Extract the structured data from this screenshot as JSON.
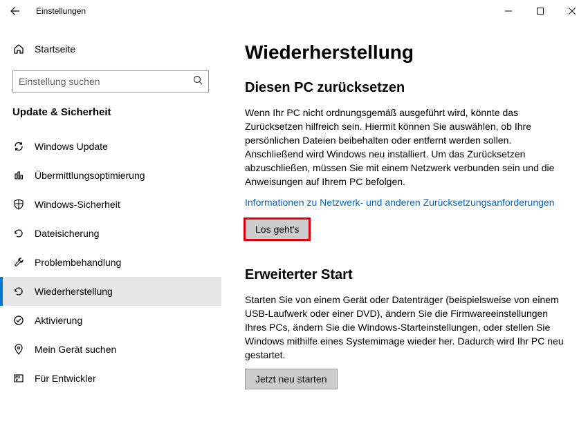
{
  "titlebar": {
    "title": "Einstellungen"
  },
  "sidebar": {
    "home_label": "Startseite",
    "search_placeholder": "Einstellung suchen",
    "category_label": "Update & Sicherheit",
    "items": [
      {
        "label": "Windows Update"
      },
      {
        "label": "Übermittlungsoptimierung"
      },
      {
        "label": "Windows-Sicherheit"
      },
      {
        "label": "Dateisicherung"
      },
      {
        "label": "Problembehandlung"
      },
      {
        "label": "Wiederherstellung"
      },
      {
        "label": "Aktivierung"
      },
      {
        "label": "Mein Gerät suchen"
      },
      {
        "label": "Für Entwickler"
      }
    ]
  },
  "main": {
    "page_title": "Wiederherstellung",
    "section1": {
      "title": "Diesen PC zurücksetzen",
      "body": "Wenn Ihr PC nicht ordnungsgemäß ausgeführt wird, könnte das Zurücksetzen hilfreich sein. Hiermit können Sie auswählen, ob Ihre persönlichen Dateien beibehalten oder entfernt werden sollen. Anschließend wird Windows neu installiert. Um das Zurücksetzen abzuschließen, müssen Sie mit einem Netzwerk verbunden sein und die Anweisungen auf Ihrem PC befolgen.",
      "link": "Informationen zu Netzwerk- und anderen Zurücksetzungsanforderungen",
      "button": "Los geht's"
    },
    "section2": {
      "title": "Erweiterter Start",
      "body": "Starten Sie von einem Gerät oder Datenträger (beispielsweise von einem USB-Laufwerk oder einer DVD), ändern Sie die Firmwareeinstellungen Ihres PCs, ändern Sie die Windows-Starteinstellungen, oder stellen Sie Windows mithilfe eines Systemimage wieder her. Dadurch wird Ihr PC neu gestartet.",
      "button": "Jetzt neu starten"
    }
  }
}
